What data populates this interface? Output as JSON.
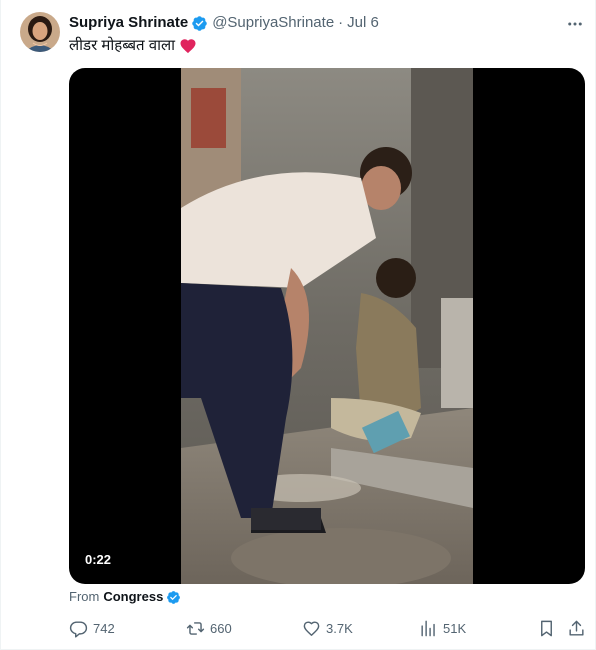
{
  "author": {
    "name": "Supriya Shrinate",
    "handle": "@SupriyaShrinate",
    "separator": "·",
    "date": "Jul 6"
  },
  "tweet": {
    "text": "लीडर मोहब्बत वाला",
    "emoji": "red-heart-icon"
  },
  "media": {
    "type": "video",
    "duration": "0:22"
  },
  "source": {
    "prefix": "From",
    "name": "Congress"
  },
  "actions": {
    "replies": "742",
    "reposts": "660",
    "likes": "3.7K",
    "views": "51K"
  },
  "colors": {
    "verified": "#1d9bf0",
    "secondary_text": "#536471",
    "heart": "#e0245e"
  }
}
